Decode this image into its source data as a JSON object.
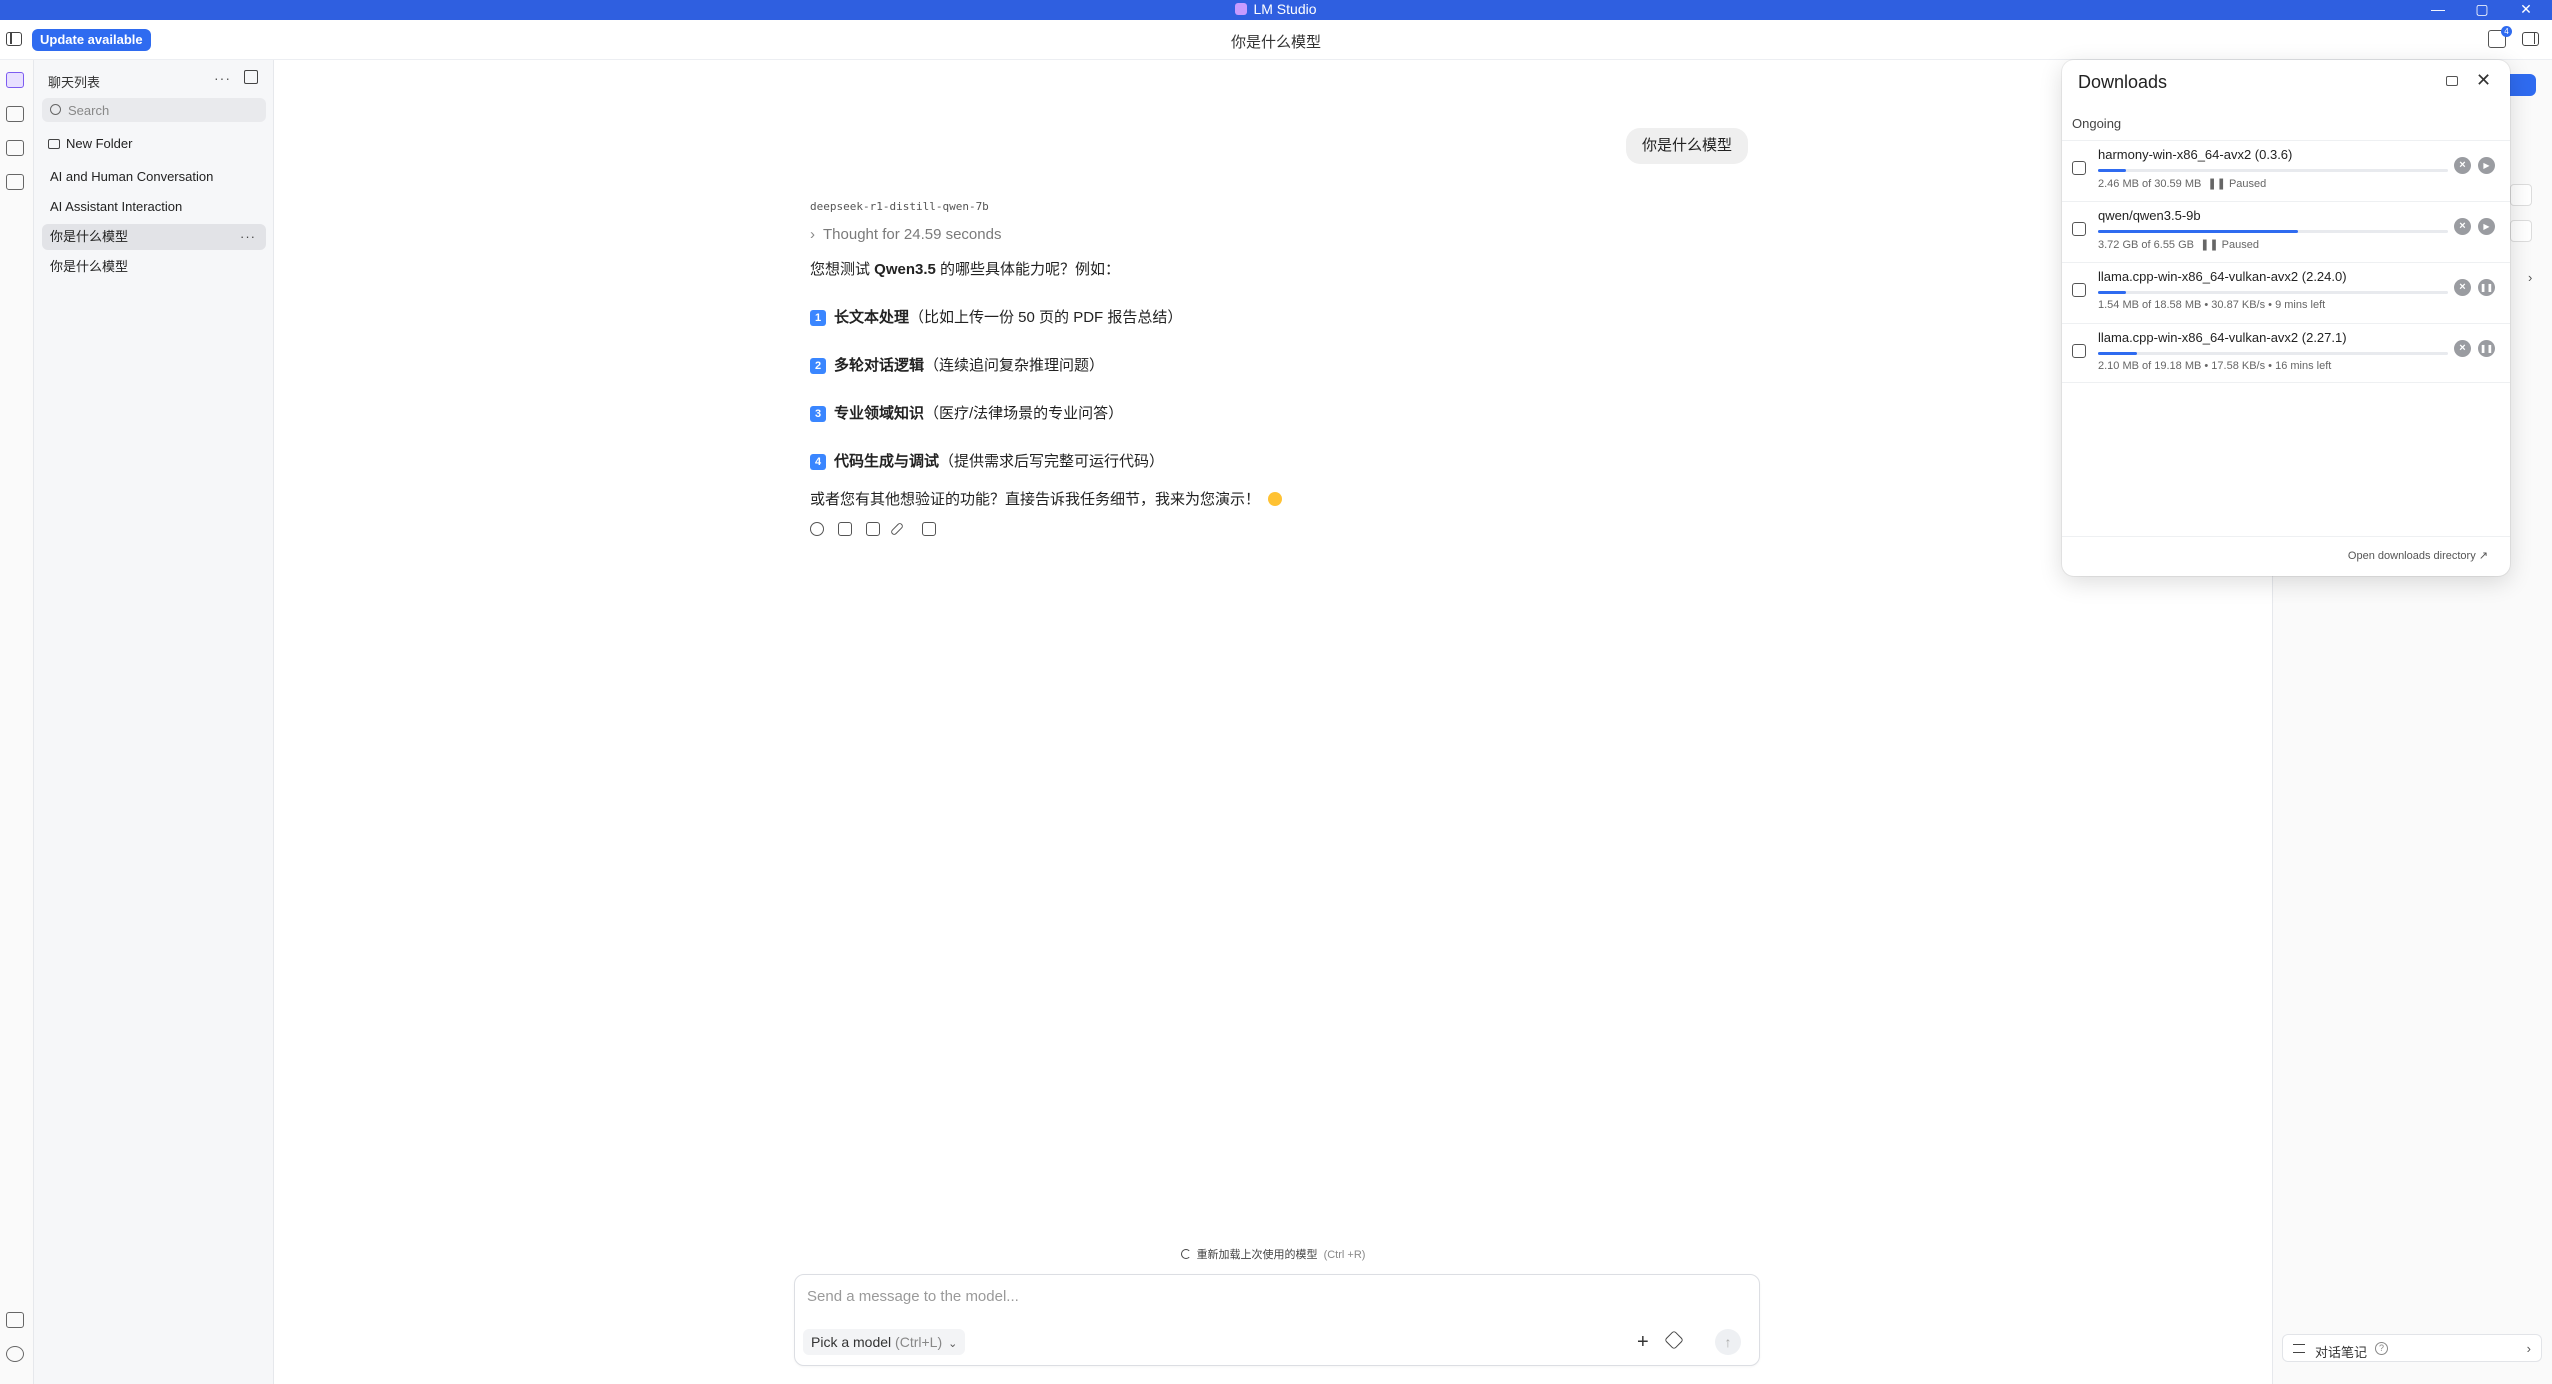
{
  "window": {
    "app_title": "LM Studio",
    "minimize_glyph": "—",
    "maximize_glyph": "▢",
    "close_glyph": "✕"
  },
  "header": {
    "update_label": "Update available",
    "title": "你是什么模型",
    "downloads_badge": "4"
  },
  "sidebar": {
    "title": "聊天列表",
    "more_glyph": "···",
    "search_placeholder": "Search",
    "new_folder_label": "New Folder",
    "items": [
      {
        "label": "AI and Human Conversation",
        "active": false
      },
      {
        "label": "AI Assistant Interaction",
        "active": false
      },
      {
        "label": "你是什么模型",
        "active": true
      },
      {
        "label": "你是什么模型",
        "active": false
      }
    ],
    "item_more_glyph": "···"
  },
  "chat": {
    "user_message": "你是什么模型",
    "model_name": "deepseek-r1-distill-qwen-7b",
    "thought_chevron": "›",
    "thought_label": "Thought for 24.59 seconds",
    "intro_prefix": "您想测试 ",
    "intro_bold": "Qwen3.5",
    "intro_suffix": " 的哪些具体能力呢？例如：",
    "capabilities": [
      {
        "badge": "1",
        "title": "长文本处理",
        "detail": "（比如上传一份 50 页的 PDF 报告总结）"
      },
      {
        "badge": "2",
        "title": "多轮对话逻辑",
        "detail": "（连续追问复杂推理问题）"
      },
      {
        "badge": "3",
        "title": "专业领域知识",
        "detail": "（医疗/法律场景的专业问答）"
      },
      {
        "badge": "4",
        "title": "代码生成与调试",
        "detail": "（提供需求后写完整可运行代码）"
      }
    ],
    "closing": "或者您有其他想验证的功能？直接告诉我任务细节，我来为您演示！"
  },
  "composer": {
    "reload_hint": "重新加载上次使用的模型",
    "reload_shortcut": "(Ctrl +R)",
    "placeholder": "Send a message to the model...",
    "model_picker_label": "Pick a model",
    "model_picker_shortcut": "(Ctrl+L)",
    "chevron_glyph": "⌄",
    "plus_glyph": "+",
    "send_glyph": "↑"
  },
  "side_panel": {
    "notes_label": "对话笔记",
    "help_glyph": "?",
    "chevron_glyph": "›"
  },
  "downloads": {
    "title": "Downloads",
    "close_glyph": "✕",
    "section_label": "Ongoing",
    "cancel_glyph": "×",
    "items": [
      {
        "name": "harmony-win-x86_64-avx2 (0.3.6)",
        "size": "2.46 MB of 30.59 MB",
        "status": "❚❚ Paused",
        "progress": 0.08,
        "state": "paused",
        "toggle_glyph": "▶"
      },
      {
        "name": "qwen/qwen3.5-9b",
        "size": "3.72 GB of 6.55 GB",
        "status": "❚❚ Paused",
        "progress": 0.57,
        "state": "paused",
        "toggle_glyph": "▶"
      },
      {
        "name": "llama.cpp-win-x86_64-vulkan-avx2 (2.24.0)",
        "size": "1.54 MB of 18.58 MB • 30.87 KB/s • 9 mins left",
        "status": "",
        "progress": 0.08,
        "state": "downloading",
        "toggle_glyph": "❚❚"
      },
      {
        "name": "llama.cpp-win-x86_64-vulkan-avx2 (2.27.1)",
        "size": "2.10 MB of 19.18 MB • 17.58 KB/s • 16 mins left",
        "status": "",
        "progress": 0.11,
        "state": "downloading",
        "toggle_glyph": "❚❚"
      }
    ],
    "open_directory_label": "Open downloads directory ↗"
  }
}
